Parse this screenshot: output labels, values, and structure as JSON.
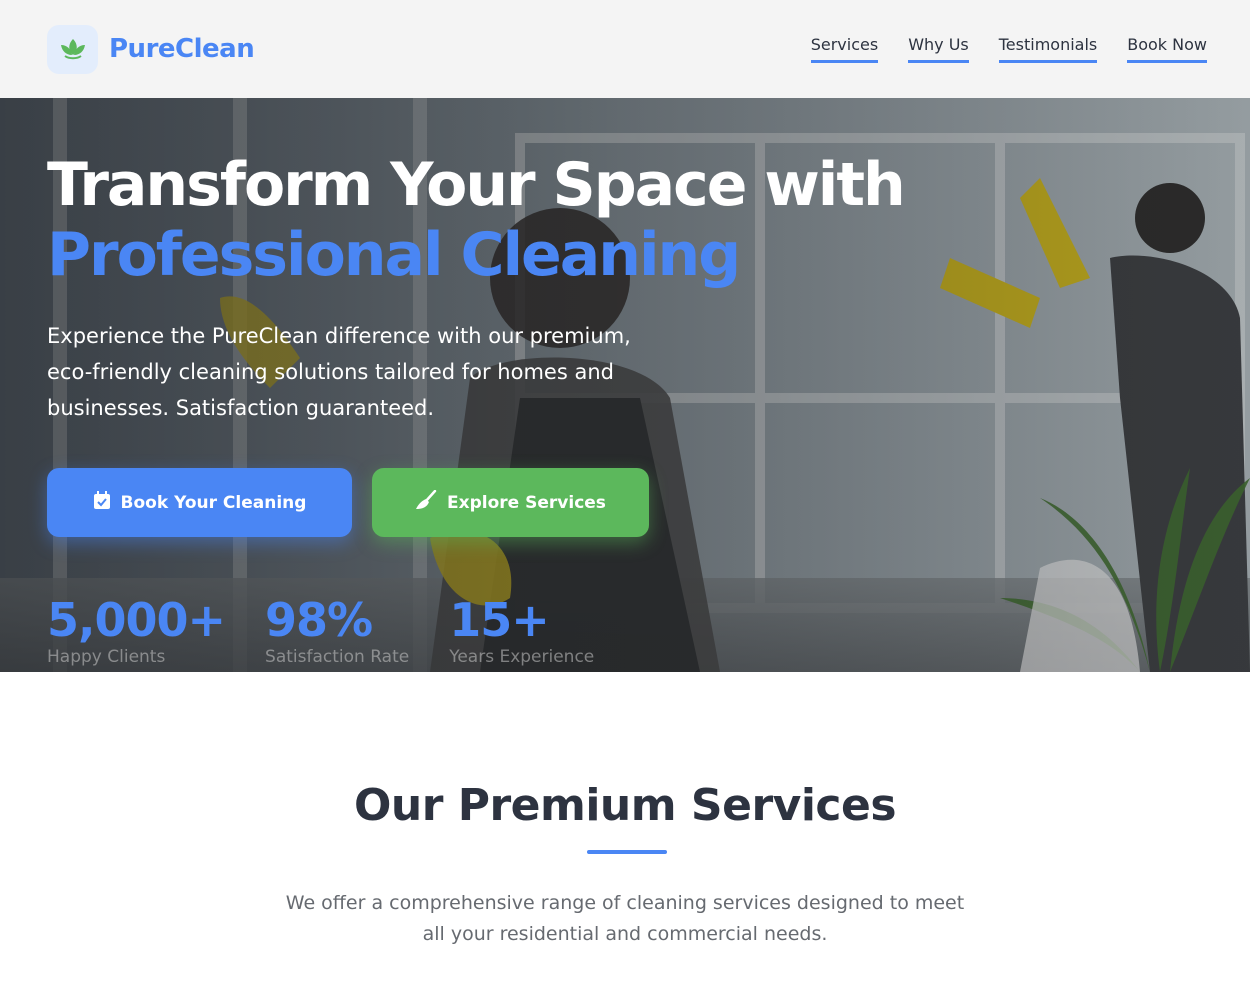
{
  "brand": {
    "name": "PureClean",
    "icon": "leaf-icon",
    "color": "#4a86f4"
  },
  "nav": {
    "items": [
      {
        "label": "Services"
      },
      {
        "label": "Why Us"
      },
      {
        "label": "Testimonials"
      },
      {
        "label": "Book Now"
      }
    ]
  },
  "hero": {
    "title_line1": "Transform Your Space with",
    "title_line2": "Professional Cleaning",
    "subtitle": "Experience the PureClean difference with our premium, eco-friendly cleaning solutions tailored for homes and businesses. Satisfaction guaranteed.",
    "primary_button": {
      "label": "Book Your Cleaning",
      "icon": "calendar-check-icon",
      "color": "#4a86f4"
    },
    "secondary_button": {
      "label": "Explore Services",
      "icon": "broom-icon",
      "color": "#5cb85c"
    },
    "stats": [
      {
        "value": "5,000+",
        "label": "Happy Clients"
      },
      {
        "value": "98%",
        "label": "Satisfaction Rate"
      },
      {
        "value": "15+",
        "label": "Years Experience"
      }
    ]
  },
  "services": {
    "title": "Our Premium Services",
    "description": "We offer a comprehensive range of cleaning services designed to meet all your residential and commercial needs."
  }
}
